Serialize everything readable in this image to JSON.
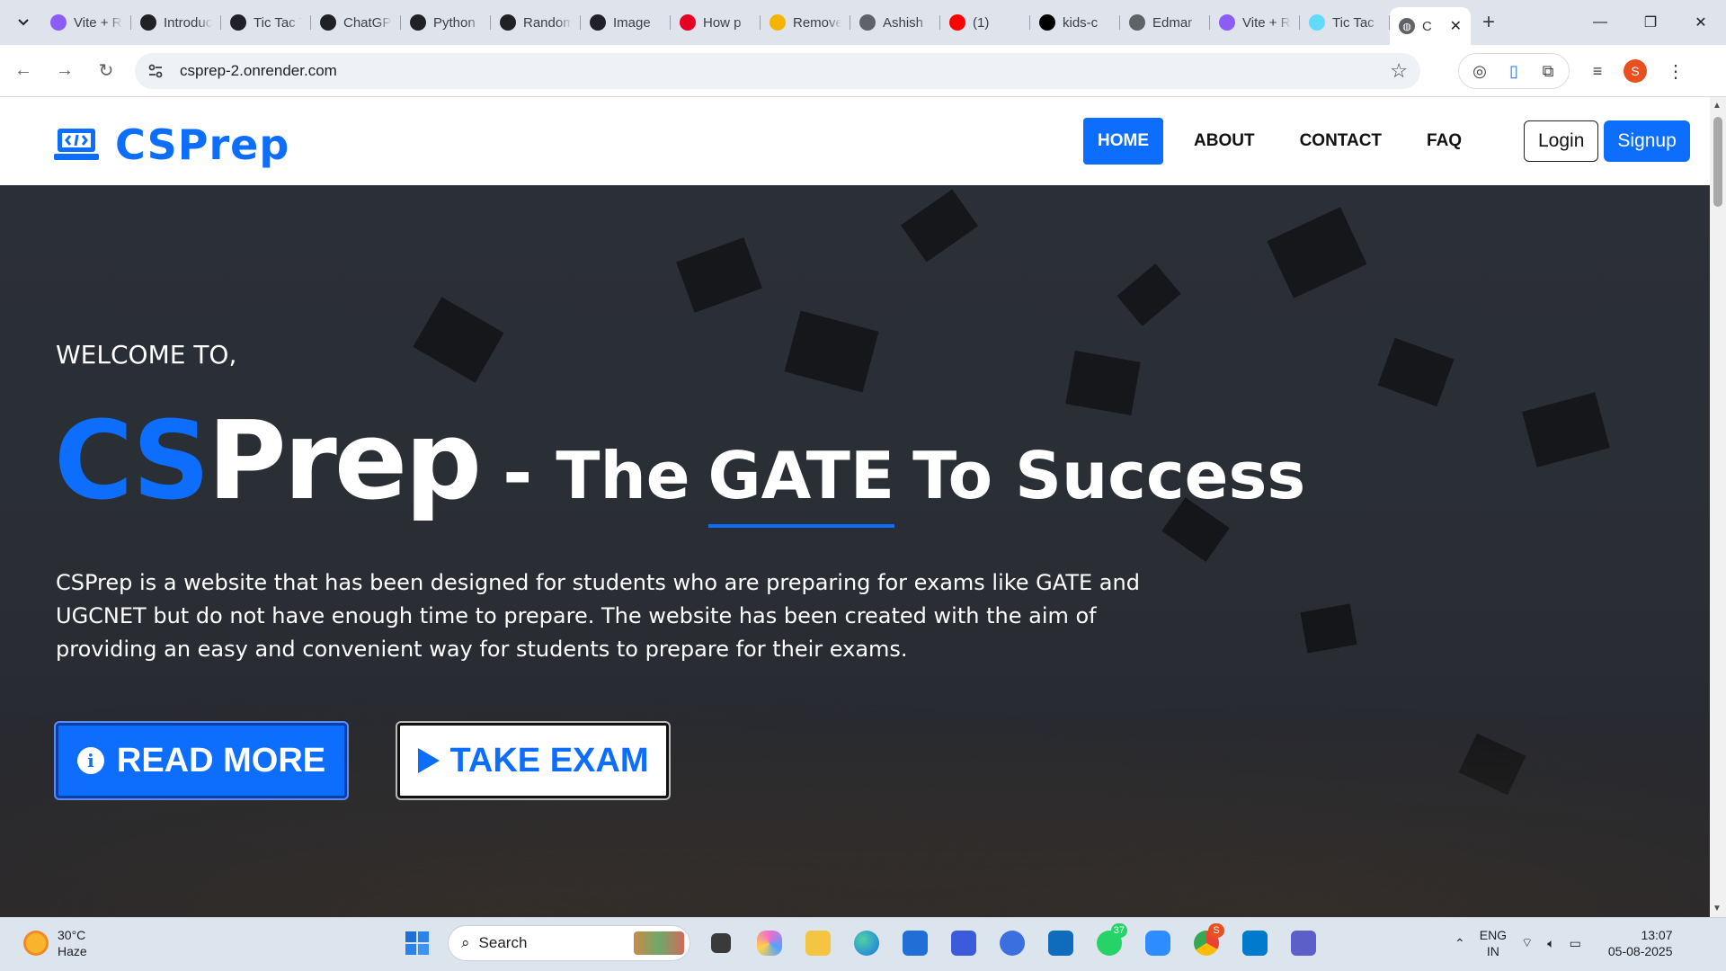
{
  "browser": {
    "tabs": [
      {
        "title": "Vite + React",
        "favicon": "vite-icon",
        "color": "#8b5cf6"
      },
      {
        "title": "Introduction",
        "favicon": "chatgpt-icon",
        "color": "#202124"
      },
      {
        "title": "Tic Tac Toe",
        "favicon": "chatgpt-icon",
        "color": "#202124"
      },
      {
        "title": "ChatGPT",
        "favicon": "chatgpt-icon",
        "color": "#202124"
      },
      {
        "title": "Python",
        "favicon": "chatgpt-icon",
        "color": "#202124"
      },
      {
        "title": "Random",
        "favicon": "chatgpt-icon",
        "color": "#202124"
      },
      {
        "title": "Image",
        "favicon": "chatgpt-icon",
        "color": "#202124"
      },
      {
        "title": "How p",
        "favicon": "pinterest-icon",
        "color": "#e60023"
      },
      {
        "title": "Remove",
        "favicon": "stack-icon",
        "color": "#f4b400"
      },
      {
        "title": "Ashish",
        "favicon": "globe-icon",
        "color": "#5f6368"
      },
      {
        "title": "(1)",
        "favicon": "youtube-icon",
        "color": "#ff0000"
      },
      {
        "title": "kids-c",
        "favicon": "tiktok-icon",
        "color": "#000000"
      },
      {
        "title": "Edmar",
        "favicon": "globe-icon",
        "color": "#5f6368"
      },
      {
        "title": "Vite + React",
        "favicon": "vite-icon",
        "color": "#8b5cf6"
      },
      {
        "title": "Tic Tac",
        "favicon": "react-icon",
        "color": "#61dafb"
      }
    ],
    "active_tab": {
      "title": "C",
      "favicon": "globe-icon"
    },
    "url": "csprep-2.onrender.com",
    "profile_initial": "S"
  },
  "site": {
    "logo_text": "CSPrep",
    "nav": {
      "home": "HOME",
      "about": "ABOUT",
      "contact": "CONTACT",
      "faq": "FAQ"
    },
    "login": "Login",
    "signup": "Signup"
  },
  "hero": {
    "welcome": "WELCOME TO,",
    "brand_cs": "CS",
    "brand_prep": "Prep",
    "dash": "-",
    "tagline_1": "The",
    "tagline_2": "GATE",
    "tagline_3": "To Success",
    "description": "CSPrep is a website that has been designed for students who are preparing for exams like GATE and UGCNET but do not have enough time to prepare. The website has been created with the aim of providing an easy and convenient way for students to prepare for their exams.",
    "read_more": "READ MORE",
    "take_exam": "TAKE EXAM"
  },
  "taskbar": {
    "weather_temp": "30°C",
    "weather_desc": "Haze",
    "search": "Search",
    "whatsapp_badge": "37",
    "chrome_badge": "S",
    "lang_1": "ENG",
    "lang_2": "IN",
    "time": "13:07",
    "date": "05-08-2025"
  },
  "colors": {
    "accent": "#0d6efd",
    "hero_bg": "#2a2d34"
  }
}
